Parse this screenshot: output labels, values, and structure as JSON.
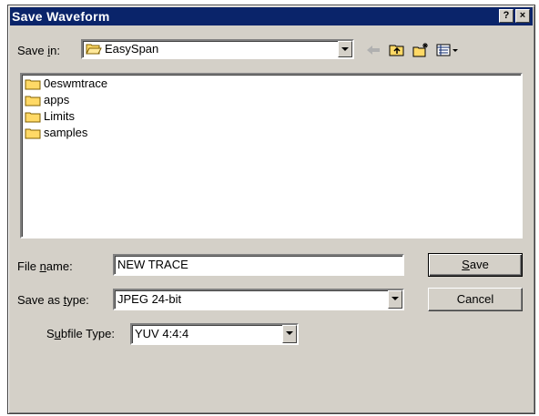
{
  "window": {
    "title": "Save Waveform",
    "help_label": "?",
    "close_label": "×"
  },
  "save_in": {
    "label_pre": "Save ",
    "label_key": "i",
    "label_post": "n:",
    "value": "EasySpan"
  },
  "toolbar": {
    "icons": [
      "back-arrow-icon",
      "up-folder-icon",
      "new-folder-icon",
      "view-menu-icon"
    ]
  },
  "files": [
    {
      "name": "0eswmtrace"
    },
    {
      "name": "apps"
    },
    {
      "name": "Limits"
    },
    {
      "name": "samples"
    }
  ],
  "file_name": {
    "label_pre": "File ",
    "label_key": "n",
    "label_post": "ame:",
    "value": "NEW TRACE"
  },
  "save_as_type": {
    "label_pre": "Save as ",
    "label_key": "t",
    "label_post": "ype:",
    "value": "JPEG 24-bit"
  },
  "subfile_type": {
    "label_pre": "S",
    "label_key": "u",
    "label_post": "bfile Type:",
    "value": "YUV 4:4:4"
  },
  "buttons": {
    "save_key": "S",
    "save_rest": "ave",
    "cancel": "Cancel"
  },
  "colors": {
    "titlebar": "#0a246a",
    "face": "#d4d0c8",
    "folder": "#ffd966"
  }
}
